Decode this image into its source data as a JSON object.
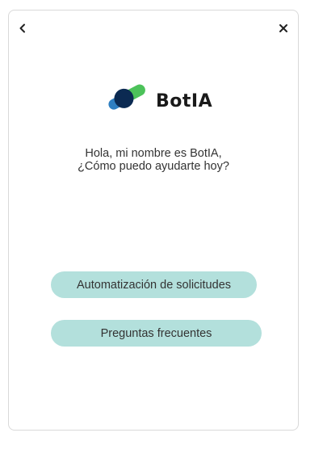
{
  "header": {
    "back_icon": "chevron-left-icon",
    "close_icon": "close-icon"
  },
  "brand": {
    "name": "BotIA",
    "logo_colors": [
      "#0b2a52",
      "#2f7fc1",
      "#4cc25a"
    ]
  },
  "greeting": {
    "line1": "Hola, mi nombre es BotIA,",
    "line2": "¿Cómo puedo ayudarte hoy?"
  },
  "options": [
    {
      "label": "Automatización de solicitudes"
    },
    {
      "label": "Preguntas frecuentes"
    }
  ],
  "colors": {
    "option_background": "#b3e0dc",
    "text": "#333333",
    "panel_border": "#d9d9d9"
  }
}
